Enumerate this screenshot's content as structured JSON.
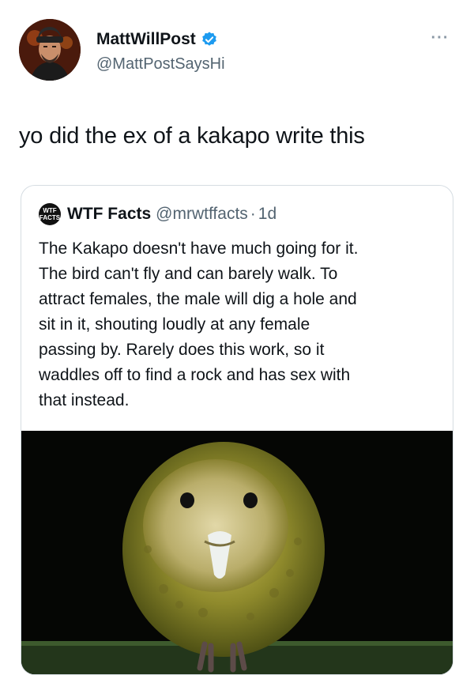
{
  "tweet": {
    "display_name": "MattWillPost",
    "handle": "@MattPostSaysHi",
    "verified_icon": "verified-badge-icon",
    "more_label": "···",
    "text": "yo did the ex of a kakapo write this"
  },
  "quoted": {
    "logo_text": "WTF FACTS",
    "name": "WTF Facts",
    "handle": "@mrwtffacts",
    "separator": "·",
    "time": "1d",
    "body_lines": [
      "The Kakapo doesn't have much going for it.",
      "The bird can't fly and can barely walk. To",
      "attract females, the male will dig a hole and",
      "sit in it, shouting loudly at any female",
      "passing by. Rarely does this work, so it",
      "waddles off to find a rock and has sex with",
      "that instead."
    ],
    "image": "kakapo-photo"
  },
  "colors": {
    "verified": "#1d9bf0",
    "secondary_text": "#536471",
    "border": "#d6dde2"
  }
}
